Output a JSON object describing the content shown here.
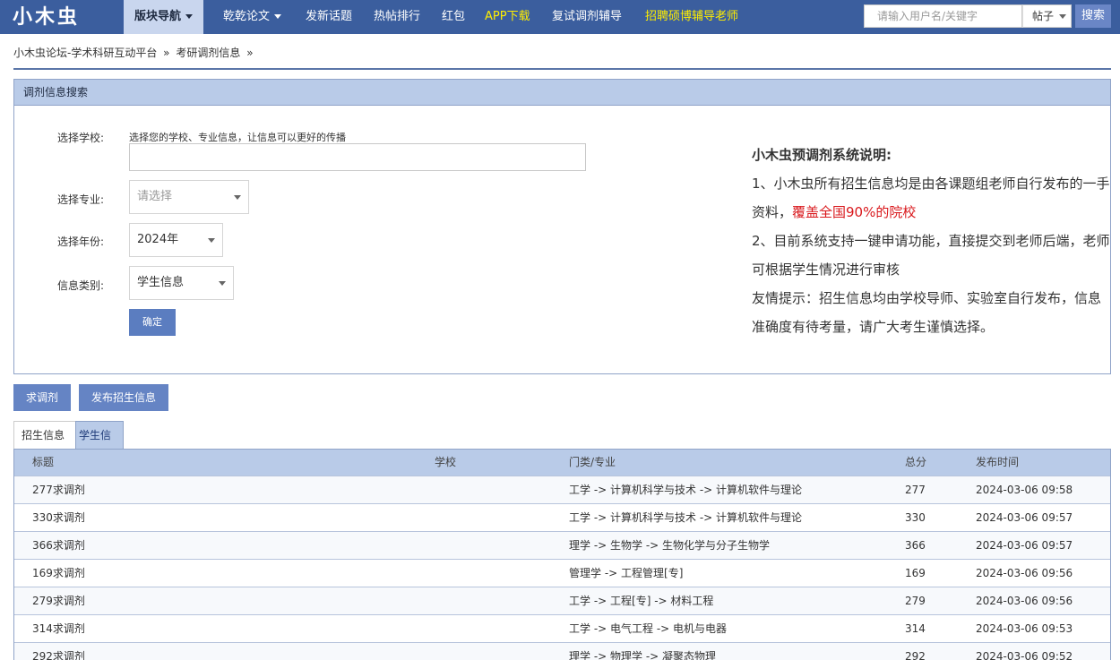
{
  "header": {
    "logo": "小木虫",
    "nav": [
      {
        "label": "版块导航",
        "dropdown": true,
        "active": true
      },
      {
        "label": "乾乾论文",
        "dropdown": true
      },
      {
        "label": "发新话题"
      },
      {
        "label": "热帖排行"
      },
      {
        "label": "红包"
      },
      {
        "label": "APP下载",
        "highlight": true
      },
      {
        "label": "复试调剂辅导"
      },
      {
        "label": "招聘硕博辅导老师",
        "highlight": true
      }
    ],
    "search": {
      "placeholder": "请输入用户名/关键字",
      "type": "帖子",
      "button": "搜索"
    }
  },
  "breadcrumb": [
    "小木虫论坛-学术科研互动平台",
    "考研调剂信息"
  ],
  "breadcrumb_sep": "»",
  "panel": {
    "title": "调剂信息搜索",
    "school_label": "选择学校:",
    "school_hint": "选择您的学校、专业信息，让信息可以更好的传播",
    "major_label": "选择专业:",
    "major_value": "请选择",
    "year_label": "选择年份:",
    "year_value": "2024年",
    "type_label": "信息类别:",
    "type_value": "学生信息",
    "confirm": "确定"
  },
  "description": {
    "title": "小木虫预调剂系统说明:",
    "line1_a": "1、小木虫所有招生信息均是由各课题组老师自行发布的一手资料，",
    "line1_b": "覆盖全国90%的院校",
    "line2": "2、目前系统支持一键申请功能，直接提交到老师后端，老师可根据学生情况进行审核",
    "line3": "友情提示：招生信息均由学校导师、实验室自行发布，信息准确度有待考量，请广大考生谨慎选择。"
  },
  "colors": {
    "nav_bg": "#3b5e9e",
    "accent": "#6584c4",
    "table_head": "#b9cbe8",
    "highlight": "#ffee00",
    "red": "#d9181c"
  },
  "actions": {
    "seek": "求调剂",
    "publish": "发布招生信息"
  },
  "tabs": {
    "recruit": "招生信息",
    "student": "学生信息"
  },
  "table": {
    "headers": [
      "标题",
      "学校",
      "门类/专业",
      "总分",
      "发布时间"
    ],
    "rows": [
      {
        "title": "277求调剂",
        "school": "",
        "major": "工学 -> 计算机科学与技术 -> 计算机软件与理论",
        "score": "277",
        "time": "2024-03-06 09:58"
      },
      {
        "title": "330求调剂",
        "school": "",
        "major": "工学 -> 计算机科学与技术 -> 计算机软件与理论",
        "score": "330",
        "time": "2024-03-06 09:57"
      },
      {
        "title": "366求调剂",
        "school": "",
        "major": "理学 -> 生物学 -> 生物化学与分子生物学",
        "score": "366",
        "time": "2024-03-06 09:57"
      },
      {
        "title": "169求调剂",
        "school": "",
        "major": "管理学 -> 工程管理[专]",
        "score": "169",
        "time": "2024-03-06 09:56"
      },
      {
        "title": "279求调剂",
        "school": "",
        "major": "工学 -> 工程[专] -> 材料工程",
        "score": "279",
        "time": "2024-03-06 09:56"
      },
      {
        "title": "314求调剂",
        "school": "",
        "major": "工学 -> 电气工程 -> 电机与电器",
        "score": "314",
        "time": "2024-03-06 09:53"
      },
      {
        "title": "292求调剂",
        "school": "",
        "major": "理学 -> 物理学 -> 凝聚态物理",
        "score": "292",
        "time": "2024-03-06 09:52"
      }
    ]
  }
}
